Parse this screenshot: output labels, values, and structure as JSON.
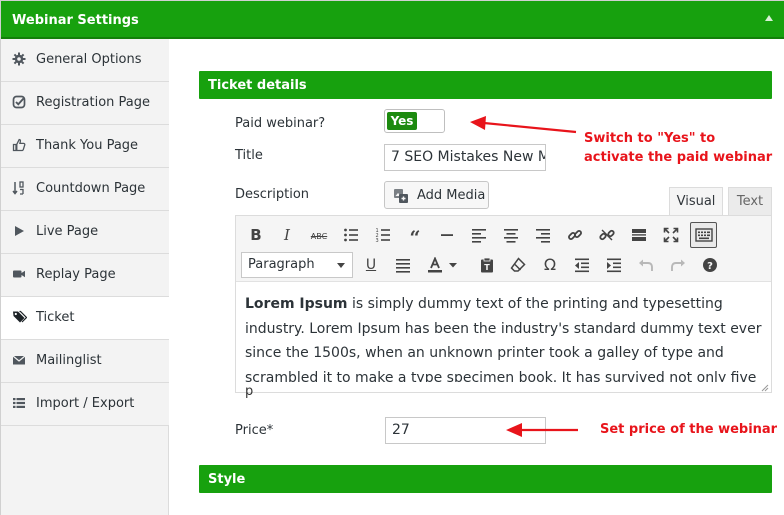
{
  "window": {
    "title": "Webinar Settings"
  },
  "sidebar": {
    "items": [
      {
        "label": "General Options",
        "icon": "gear-icon",
        "active": false
      },
      {
        "label": "Registration Page",
        "icon": "check-circle-icon",
        "active": false
      },
      {
        "label": "Thank You Page",
        "icon": "thumbs-up-icon",
        "active": false
      },
      {
        "label": "Countdown Page",
        "icon": "sort-icon",
        "active": false
      },
      {
        "label": "Live Page",
        "icon": "play-icon",
        "active": false
      },
      {
        "label": "Replay Page",
        "icon": "video-camera-icon",
        "active": false
      },
      {
        "label": "Ticket",
        "icon": "tags-icon",
        "active": true
      },
      {
        "label": "Mailinglist",
        "icon": "envelope-icon",
        "active": false
      },
      {
        "label": "Import / Export",
        "icon": "list-icon",
        "active": false
      }
    ]
  },
  "ticket_section": {
    "title": "Ticket details",
    "paid_label": "Paid webinar?",
    "paid_value": "Yes",
    "title_label": "Title",
    "title_value": "7 SEO Mistakes New M",
    "description_label": "Description",
    "add_media_label": "Add Media",
    "price_label": "Price*",
    "price_value": "27"
  },
  "editor": {
    "tab_visual": "Visual",
    "tab_text": "Text",
    "format_select": "Paragraph",
    "content_bold": "Lorem Ipsum",
    "content_rest": " is simply dummy text of the printing and typesetting industry. Lorem Ipsum has been the industry's standard dummy text ever since the 1500s, when an unknown printer took a galley of type and scrambled it to make a type specimen book. It has survived not only five centuries, but also the leap into electronic typesetting.",
    "status_path": "p"
  },
  "style_section": {
    "title": "Style"
  },
  "annotations": {
    "switch_line1": "Switch to \"Yes\" to",
    "switch_line2": "activate the paid webinar",
    "price_note": "Set price of the webinar"
  },
  "colors": {
    "header_green": "#17a10e",
    "toggle_green": "#1c8a0f",
    "annotation_red": "#e8141b"
  }
}
